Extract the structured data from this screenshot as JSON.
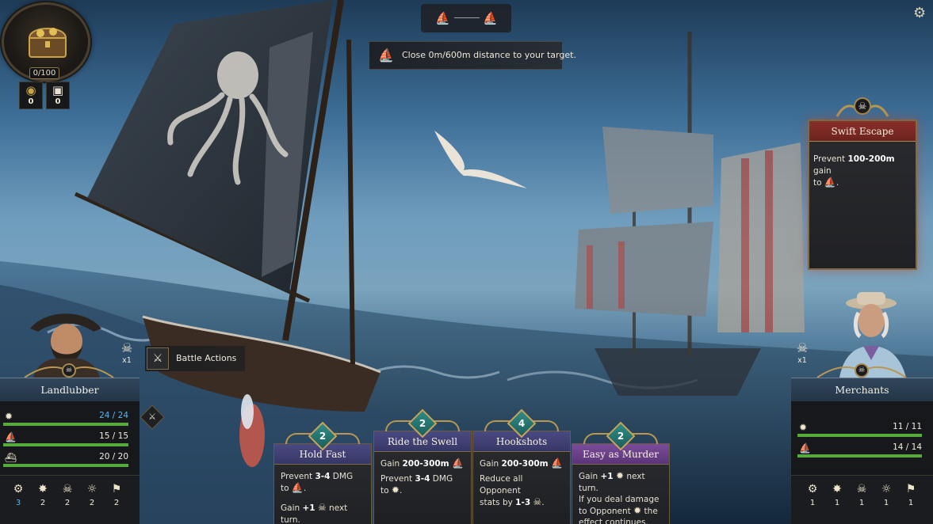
{
  "hud": {
    "treasure": {
      "icon": "treasure-chest-icon",
      "count": "0/100"
    },
    "resources": [
      {
        "icon": "gold-coin-icon",
        "value": "0"
      },
      {
        "icon": "supply-crate-icon",
        "value": "0"
      }
    ],
    "distance_meter": {
      "left_icon": "ship-icon",
      "right_icon": "ship-icon"
    },
    "objective": {
      "icon": "ship-icon",
      "text": "Close 0m/600m distance to your target."
    },
    "settings_icon": "gear-icon"
  },
  "enemy_intent": {
    "title": "Swift Escape",
    "desc_prefix": "Prevent ",
    "desc_bold": "100-200m",
    "desc_suffix": " gain",
    "desc_line2": "to",
    "desc_icon": "sail-icon"
  },
  "player": {
    "name": "Landlubber",
    "multiplier": "x1",
    "stats": [
      {
        "icon": "sun-crew-icon",
        "value": "24 / 24",
        "fill": 1.0,
        "highlight": true
      },
      {
        "icon": "sail-icon",
        "value": "15 / 15",
        "fill": 1.0,
        "highlight": false
      },
      {
        "icon": "hull-icon",
        "value": "20 / 20",
        "fill": 1.0,
        "highlight": false
      }
    ],
    "effects": [
      {
        "icon": "gear-badge-icon",
        "value": "3",
        "highlight": true
      },
      {
        "icon": "sword-burst-icon",
        "value": "2",
        "highlight": false
      },
      {
        "icon": "skull-badge-icon",
        "value": "2",
        "highlight": false
      },
      {
        "icon": "sun-badge-icon",
        "value": "2",
        "highlight": false
      },
      {
        "icon": "flag-badge-icon",
        "value": "2",
        "highlight": false
      }
    ]
  },
  "opponent": {
    "name": "Merchants",
    "multiplier": "x1",
    "stats": [
      {
        "icon": "sun-crew-icon",
        "value": "11 / 11",
        "fill": 1.0
      },
      {
        "icon": "sail-icon",
        "value": "14 / 14",
        "fill": 1.0
      }
    ],
    "effects": [
      {
        "icon": "gear-badge-icon",
        "value": "1"
      },
      {
        "icon": "sword-burst-icon",
        "value": "1"
      },
      {
        "icon": "skull-badge-icon",
        "value": "1"
      },
      {
        "icon": "sun-badge-icon",
        "value": "1"
      },
      {
        "icon": "flag-badge-icon",
        "value": "1"
      }
    ]
  },
  "battle_actions": {
    "label": "Battle Actions",
    "icon": "crossed-swords-icon"
  },
  "cards": [
    {
      "cost": "2",
      "title": "Hold Fast",
      "line1_prefix": "Prevent ",
      "line1_bold": "3-4",
      "line1_suffix": " DMG",
      "line1b": "to",
      "line2_prefix": "Gain ",
      "line2_bold": "+1",
      "line2_suffix": " next turn."
    },
    {
      "cost": "2",
      "title": "Ride the Swell",
      "line1_prefix": "Gain ",
      "line1_bold": "200-300m",
      "line1_suffix": "",
      "line2_prefix": "Prevent ",
      "line2_bold": "3-4",
      "line2_suffix": " DMG",
      "line2b": "to"
    },
    {
      "cost": "4",
      "title": "Hookshots",
      "line1_prefix": "Gain ",
      "line1_bold": "200-300m",
      "line1_suffix": "",
      "line2": "Reduce all Opponent",
      "line3_prefix": "stats by ",
      "line3_bold": "1-3",
      "line3_suffix": ""
    },
    {
      "cost": "2",
      "title": "Easy as Murder",
      "line1_prefix": "Gain ",
      "line1_bold": "+1",
      "line1_suffix": " next turn.",
      "line2": "If you deal damage",
      "line3": "to Opponent",
      "line3_suffix": " the",
      "line4": "effect continues."
    }
  ],
  "colors": {
    "accent_gold": "#b89851",
    "health_green": "#55ac3c",
    "highlight_blue": "#55b7ee",
    "enemy_red": "#8a2f2a",
    "card_purple": "#7a4c9a",
    "card_indigo": "#4a4a83",
    "gem_teal": "#2f8c86"
  }
}
